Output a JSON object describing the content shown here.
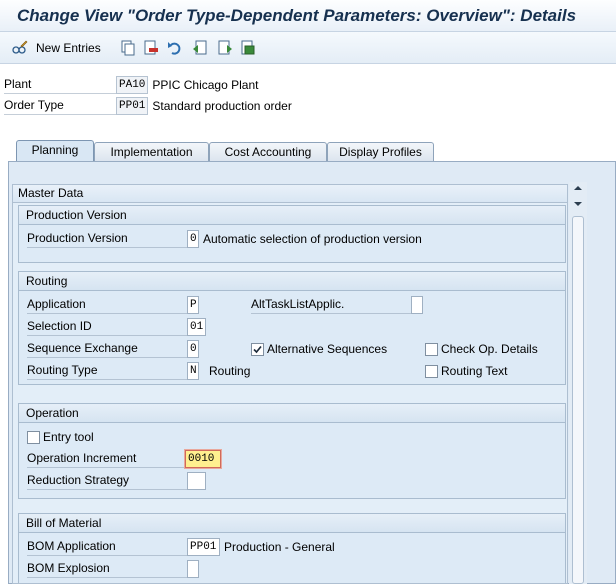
{
  "title": "Change View \"Order Type-Dependent Parameters: Overview\": Details",
  "toolbar": {
    "new_entries": "New Entries",
    "icons": [
      "glasses-pencil-icon",
      "copy-icon",
      "delete-icon",
      "undo-icon",
      "previous-entry-icon",
      "next-entry-icon",
      "select-all-icon"
    ]
  },
  "header": {
    "plant_label": "Plant",
    "plant_value": "PA10",
    "plant_desc": "PPIC Chicago Plant",
    "order_type_label": "Order Type",
    "order_type_value": "PP01",
    "order_type_desc": "Standard production order"
  },
  "tabs": [
    "Planning",
    "Implementation",
    "Cost Accounting",
    "Display Profiles"
  ],
  "active_tab": "Planning",
  "master_data": {
    "title": "Master Data",
    "production_version": {
      "title": "Production Version",
      "label": "Production Version",
      "value": "0",
      "desc": "Automatic selection of production version"
    },
    "routing": {
      "title": "Routing",
      "application_label": "Application",
      "application_value": "P",
      "alt_task_label": "AltTaskListApplic.",
      "alt_task_value": "",
      "selection_id_label": "Selection ID",
      "selection_id_value": "01",
      "seq_exchange_label": "Sequence Exchange",
      "seq_exchange_value": "0",
      "alt_sequences_label": "Alternative Sequences",
      "alt_sequences_checked": true,
      "check_op_label": "Check Op. Details",
      "check_op_checked": false,
      "routing_type_label": "Routing Type",
      "routing_type_value": "N",
      "routing_type_desc": "Routing",
      "routing_text_label": "Routing Text",
      "routing_text_checked": false
    },
    "operation": {
      "title": "Operation",
      "entry_tool_label": "Entry tool",
      "entry_tool_checked": false,
      "op_increment_label": "Operation Increment",
      "op_increment_value": "0010",
      "reduction_label": "Reduction Strategy",
      "reduction_value": ""
    },
    "bom": {
      "title": "Bill of Material",
      "application_label": "BOM Application",
      "application_value": "PP01",
      "application_desc": "Production - General",
      "explosion_label": "BOM Explosion",
      "explosion_value": ""
    }
  },
  "colors": {
    "title": "#16304f",
    "panel": "#e3eef8",
    "focus_field": "#ffef8f"
  }
}
